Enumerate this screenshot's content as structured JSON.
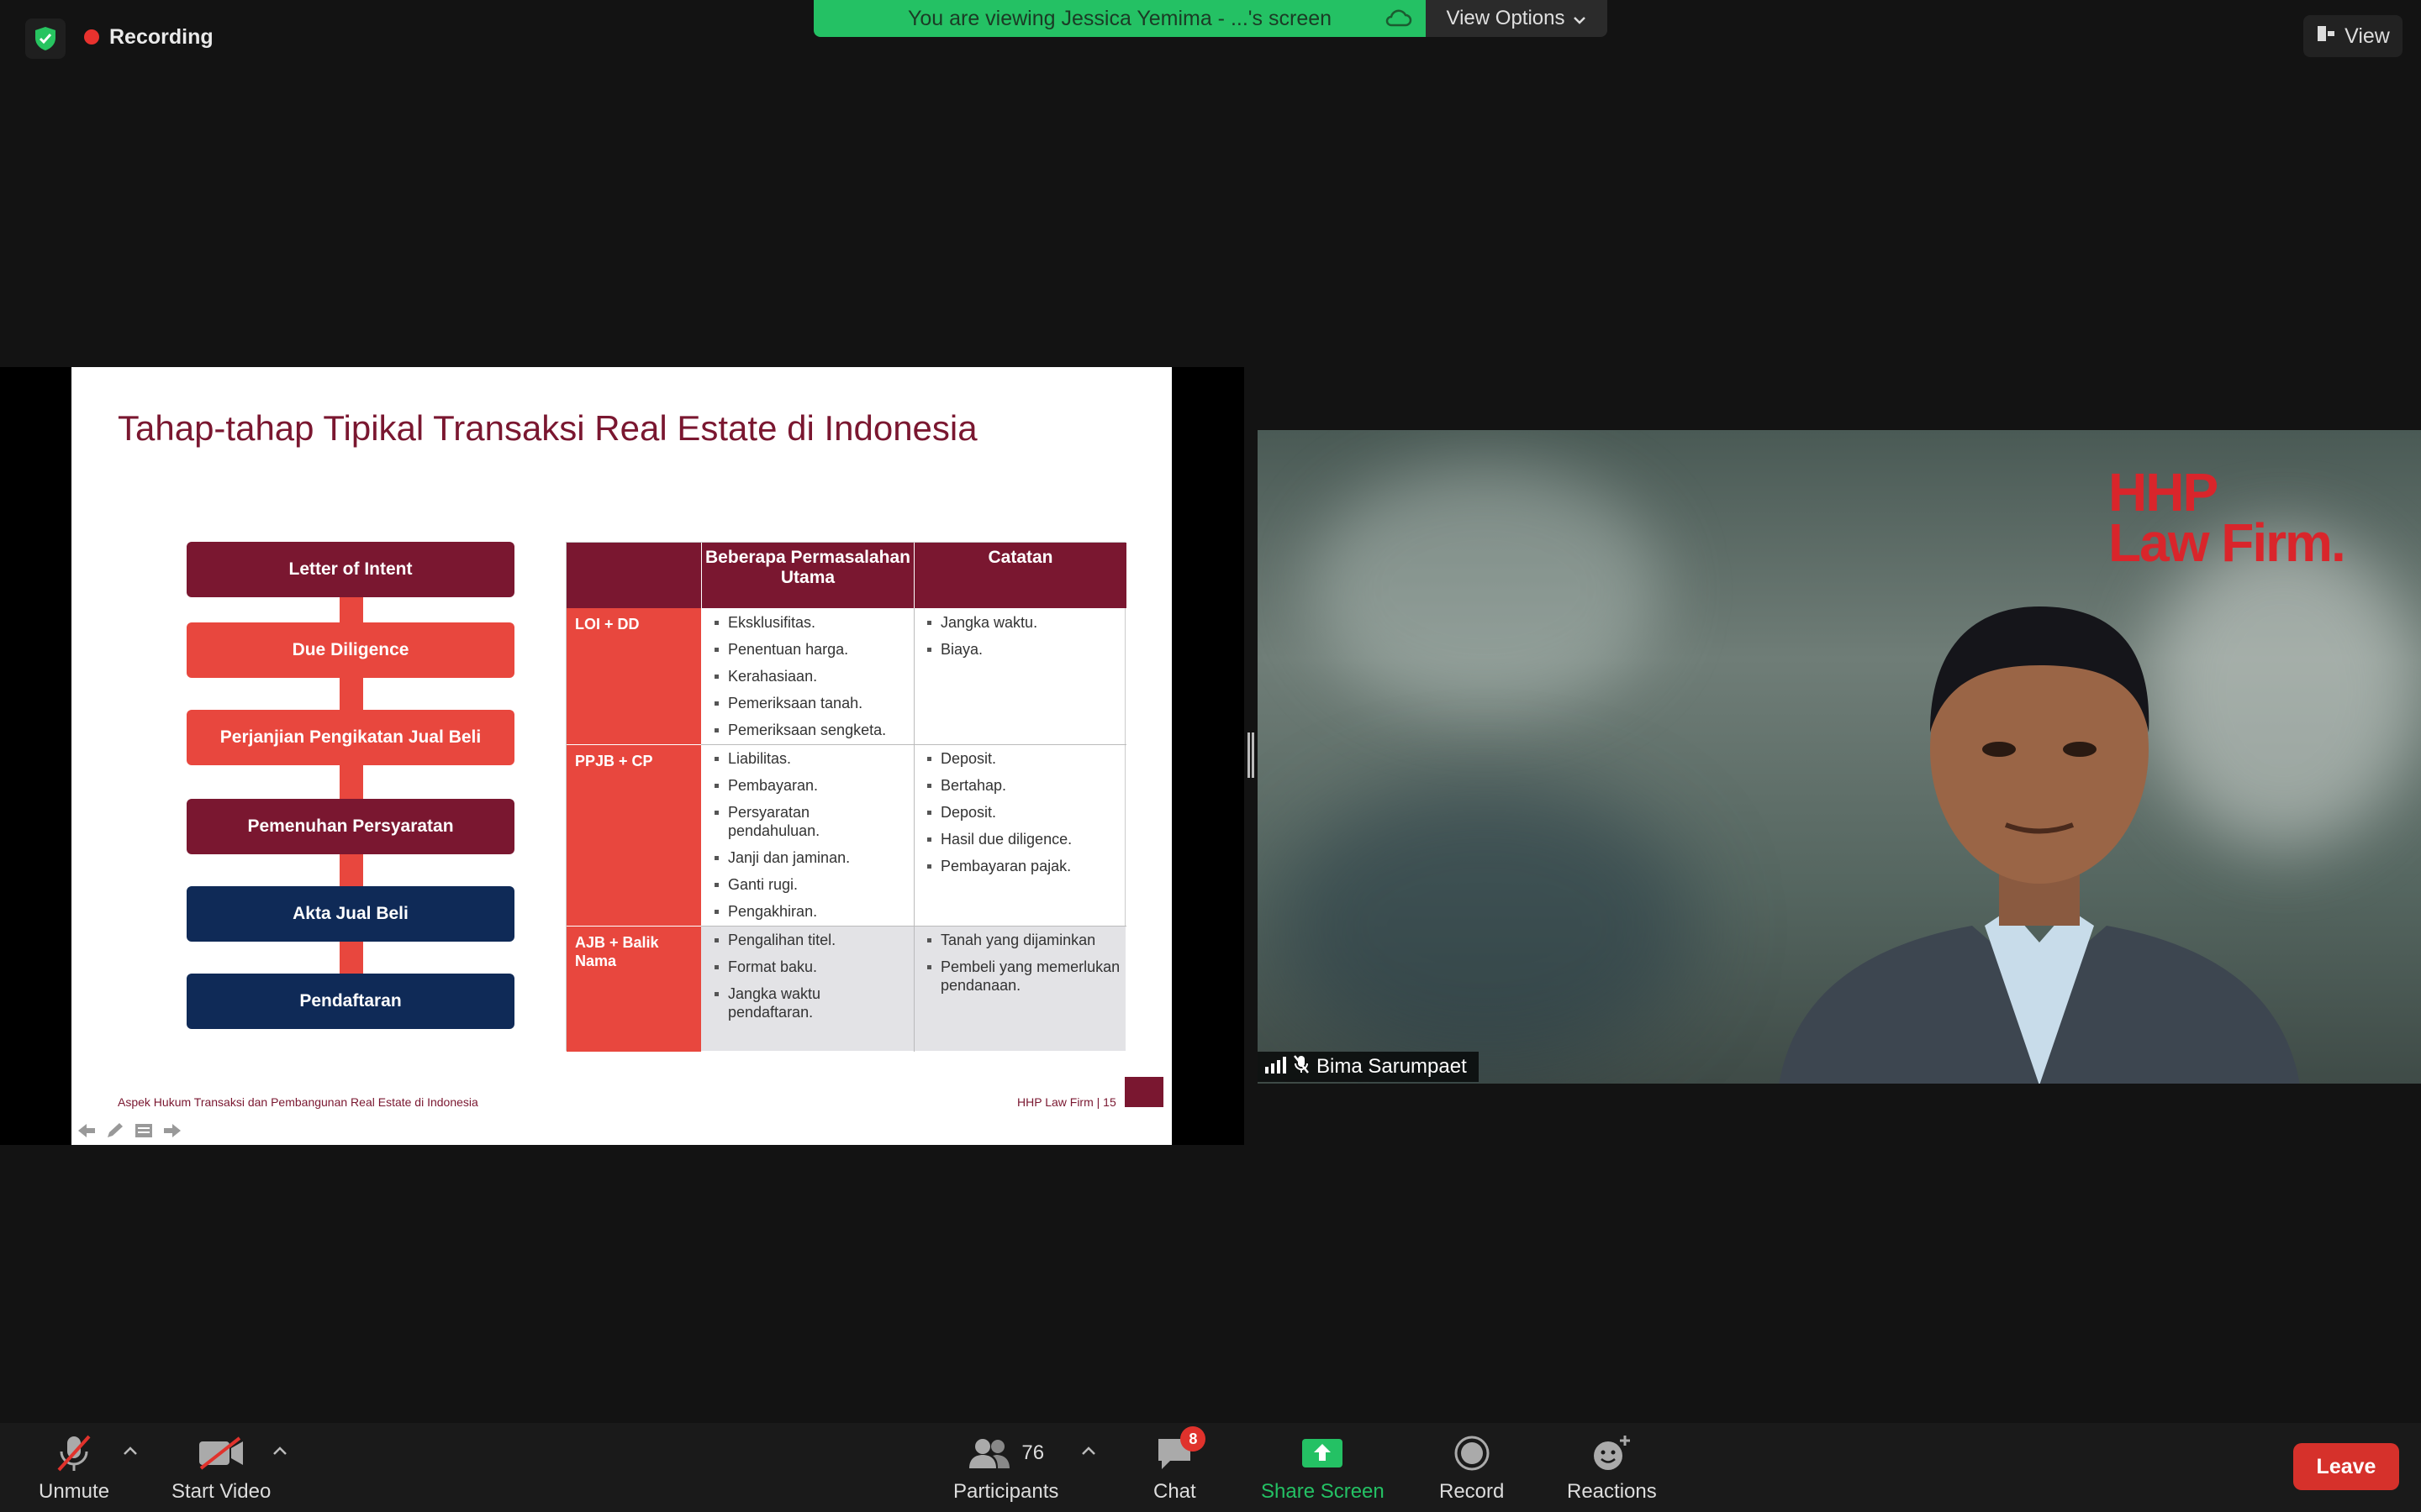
{
  "topbar": {
    "recording_label": "Recording",
    "banner_text": "You are viewing Jessica Yemima - ...'s screen",
    "view_options_label": "View Options",
    "view_label": "View"
  },
  "slide": {
    "title": "Tahap-tahap Tipikal Transaksi Real Estate di Indonesia",
    "steps": [
      "Letter of Intent",
      "Due Diligence",
      "Perjanjian Pengikatan Jual Beli",
      "Pemenuhan Persyaratan",
      "Akta Jual Beli",
      "Pendaftaran"
    ],
    "table": {
      "headers": [
        "Beberapa Permasalahan Utama",
        "Catatan"
      ],
      "rows": [
        {
          "label": "LOI + DD",
          "issues": [
            "Eksklusifitas.",
            "Penentuan harga.",
            "Kerahasiaan.",
            "Pemeriksaan tanah.",
            "Pemeriksaan sengketa."
          ],
          "notes": [
            "Jangka waktu.",
            "Biaya."
          ]
        },
        {
          "label": "PPJB + CP",
          "issues": [
            "Liabilitas.",
            "Pembayaran.",
            "Persyaratan pendahuluan.",
            "Janji dan jaminan.",
            "Ganti rugi.",
            "Pengakhiran."
          ],
          "notes": [
            "Deposit.",
            "Bertahap.",
            "Deposit.",
            "Hasil due diligence.",
            "Pembayaran pajak."
          ]
        },
        {
          "label": "AJB + Balik Nama",
          "issues": [
            "Pengalihan titel.",
            "Format baku.",
            "Jangka waktu pendaftaran."
          ],
          "notes": [
            "Tanah yang dijaminkan",
            "Pembeli yang memerlukan pendanaan."
          ]
        }
      ]
    },
    "footer_left": "Aspek Hukum Transaksi dan Pembangunan Real Estate di Indonesia",
    "footer_right": "HHP Law Firm | 15"
  },
  "video": {
    "logo_line1": "HHP",
    "logo_line2": "Law Firm.",
    "participant_name": "Bima Sarumpaet"
  },
  "toolbar": {
    "unmute_label": "Unmute",
    "start_video_label": "Start Video",
    "participants_label": "Participants",
    "participants_count": "76",
    "chat_label": "Chat",
    "chat_badge": "8",
    "share_label": "Share Screen",
    "record_label": "Record",
    "reactions_label": "Reactions",
    "leave_label": "Leave"
  },
  "colors": {
    "share_green": "#24c164",
    "slide_maroon": "#7a1730",
    "slide_red": "#e8473e",
    "slide_navy": "#0f2a57",
    "leave_red": "#d6312b"
  }
}
